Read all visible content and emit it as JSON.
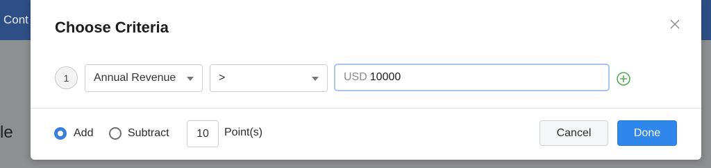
{
  "background": {
    "header_text": "Cont",
    "content_text": "le"
  },
  "modal": {
    "title": "Choose Criteria",
    "close_icon": "close-icon",
    "criteria": {
      "row_number": "1",
      "field": "Annual Revenue",
      "operator": ">",
      "currency": "USD",
      "value": "10000",
      "add_icon": "plus-circle-icon"
    },
    "scoring": {
      "add_label": "Add",
      "subtract_label": "Subtract",
      "selected": "Add",
      "points_value": "10",
      "points_label": "Point(s)"
    },
    "buttons": {
      "cancel": "Cancel",
      "done": "Done"
    }
  },
  "colors": {
    "accent": "#2f86eb",
    "add_icon": "#4caf50",
    "input_focus": "#a9c4f0"
  }
}
